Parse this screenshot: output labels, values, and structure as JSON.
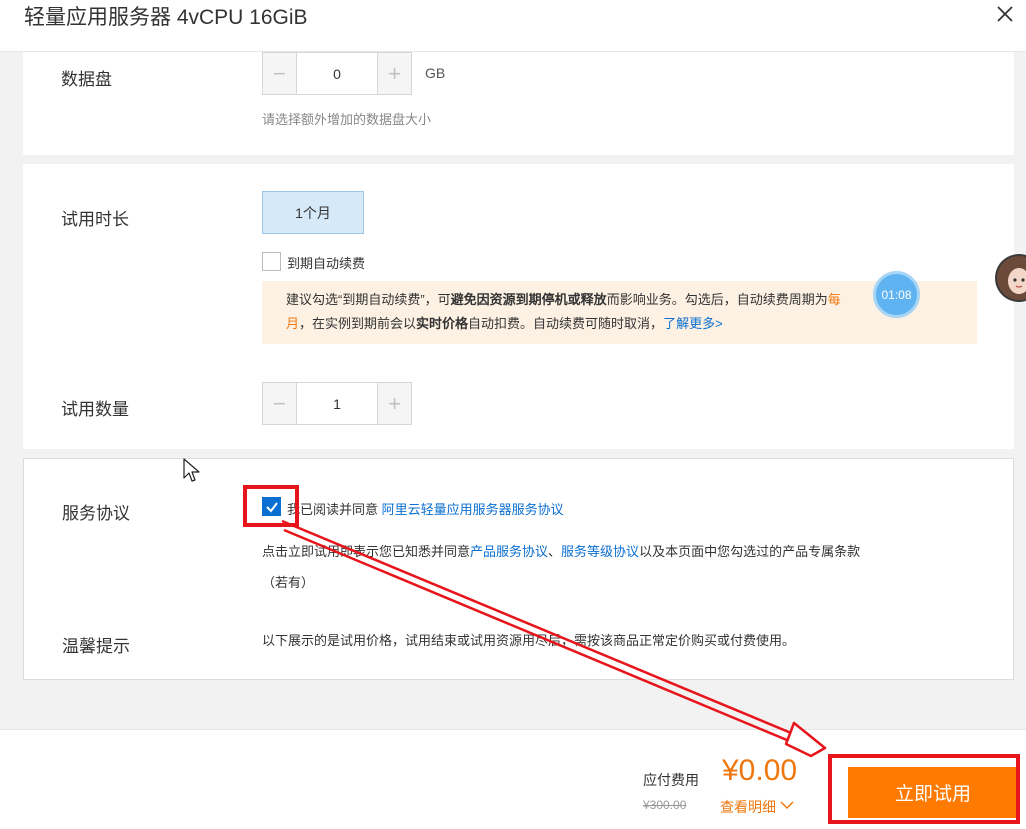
{
  "dialog": {
    "title": "轻量应用服务器 4vCPU 16GiB"
  },
  "data_disk": {
    "label": "数据盘",
    "value": "0",
    "unit": "GB",
    "hint": "请选择额外增加的数据盘大小"
  },
  "trial_duration": {
    "label": "试用时长",
    "option": "1个月",
    "auto_renew_label": "到期自动续费",
    "notice": {
      "t1": "建议勾选“到期自动续费”，可",
      "t2": "避免因资源到期停机或释放",
      "t3": "而影响业务。勾选后，自动续费周期为",
      "t4": "每",
      "t5": "月",
      "t6": "，在实例到期前会以",
      "t7": "实时价格",
      "t8": "自动扣费。自动续费可随时取消，",
      "link": "了解更多>"
    }
  },
  "trial_quantity": {
    "label": "试用数量",
    "value": "1"
  },
  "agreement": {
    "label": "服务协议",
    "check_text": "我已阅读并同意",
    "link": "阿里云轻量应用服务器服务协议",
    "checked": true,
    "terms_prefix": "点击立即试用即表示您已知悉并同意",
    "terms_link1": "产品服务协议",
    "terms_sep": "、",
    "terms_link2": "服务等级协议",
    "terms_suffix": "以及本页面中您勾选过的产品专属条款",
    "terms_note": "（若有）"
  },
  "tips": {
    "label": "温馨提示",
    "text": "以下展示的是试用价格，试用结束或试用资源用尽后，需按该商品正常定价购买或付费使用。"
  },
  "timer": "01:08",
  "footer": {
    "pay_label": "应付费用",
    "price": "¥0.00",
    "original_price": "¥300.00",
    "detail_link": "查看明细",
    "buy_button": "立即试用"
  },
  "colors": {
    "accent_orange": "#ff7a00",
    "link_blue": "#0b6fd1",
    "annotation_red": "#e8141b"
  },
  "icons": [
    "close-icon",
    "minus-icon",
    "plus-icon",
    "check-icon",
    "chevron-down-icon",
    "mouse-cursor-icon",
    "avatar",
    "red-arrow"
  ]
}
